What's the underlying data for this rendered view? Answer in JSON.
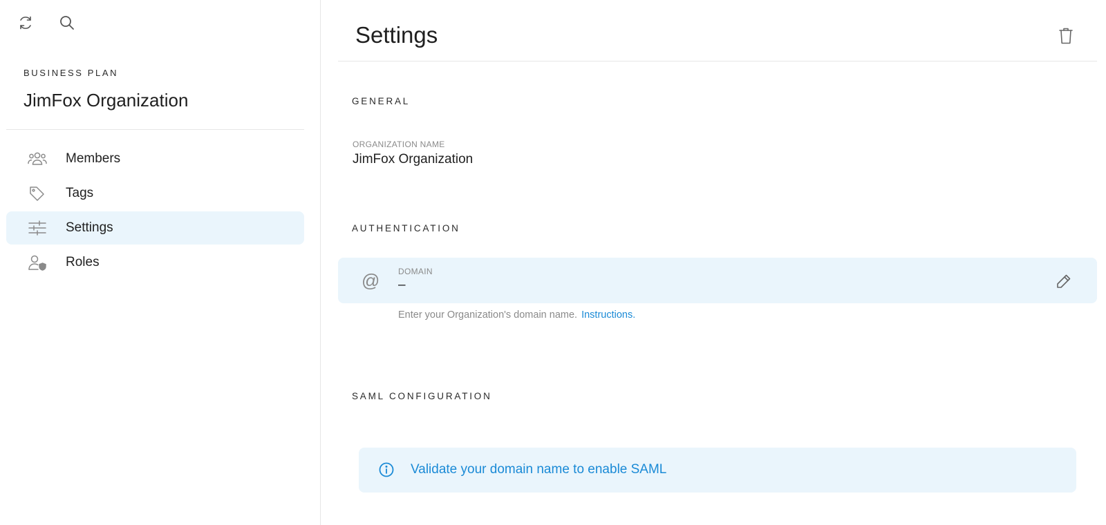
{
  "sidebar": {
    "top_icons": [
      {
        "icon": "refresh-icon"
      },
      {
        "icon": "search-icon"
      }
    ],
    "plan": "BUSINESS PLAN",
    "organization": "JimFox Organization",
    "items": [
      {
        "label": "Members",
        "icon": "members-icon",
        "active": false
      },
      {
        "label": "Tags",
        "icon": "tag-icon",
        "active": false
      },
      {
        "label": "Settings",
        "icon": "sliders-icon",
        "active": true
      },
      {
        "label": "Roles",
        "icon": "user-shield-icon",
        "active": false
      }
    ]
  },
  "main": {
    "title": "Settings",
    "delete_icon": "trash-icon",
    "general": {
      "title": "GENERAL",
      "org_name_label": "ORGANIZATION NAME",
      "org_name_value": "JimFox Organization"
    },
    "authentication": {
      "title": "AUTHENTICATION",
      "domain_icon": "@",
      "domain_label": "DOMAIN",
      "domain_value": "–",
      "helper_text": "Enter your Organization's domain name.",
      "helper_link": "Instructions."
    },
    "saml": {
      "title": "SAML CONFIGURATION",
      "banner_text": "Validate your domain name to enable SAML"
    }
  },
  "colors": {
    "accent": "#1a8ad6",
    "active_bg": "#eaf5fc",
    "muted_text": "#8a8a8a"
  }
}
